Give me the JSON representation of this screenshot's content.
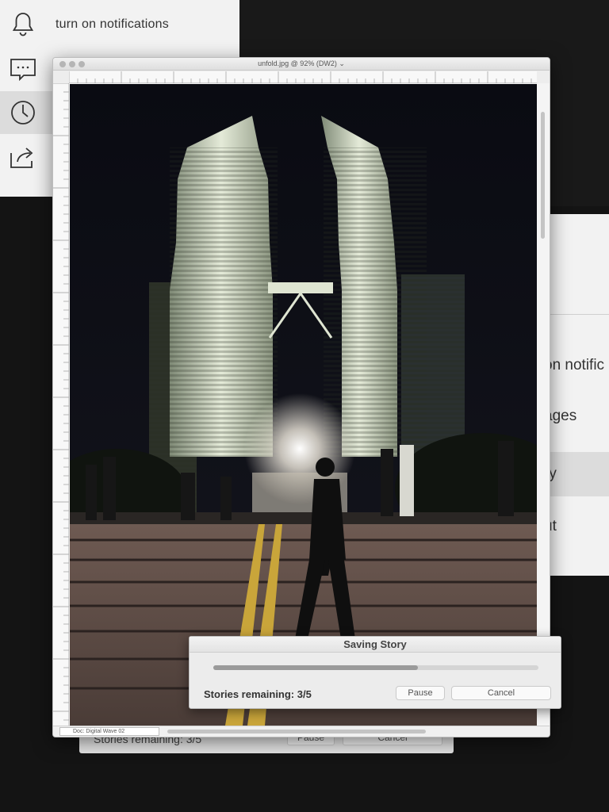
{
  "menu": {
    "items": [
      {
        "icon": "bell-icon",
        "label": "turn on notifications"
      },
      {
        "icon": "message-icon",
        "label": ""
      },
      {
        "icon": "clock-icon",
        "label": ""
      },
      {
        "icon": "share-icon",
        "label": ""
      }
    ]
  },
  "right_panel": {
    "items": [
      {
        "label": "on notific"
      },
      {
        "label": "ages"
      },
      {
        "label": "ry"
      },
      {
        "label": "ut"
      }
    ]
  },
  "window": {
    "title": "unfold.jpg @ 92% (DW2) ⌄",
    "doc_label": "Doc: Digital Wave 02"
  },
  "dialog": {
    "title": "Saving Story",
    "progress": 0.63,
    "remaining_text": "Stories remaining: 3/5",
    "pause_label": "Pause",
    "cancel_label": "Cancel"
  },
  "ghost_dialog": {
    "remaining_text": "Stories remaining: 3/5",
    "pause_label": "Pause",
    "cancel_label": "Cancel"
  },
  "colors": {
    "background": "#141414",
    "panel": "#f2f2f2",
    "active_row": "#dcdcdc",
    "progress_fill": "#9a9a9a"
  }
}
